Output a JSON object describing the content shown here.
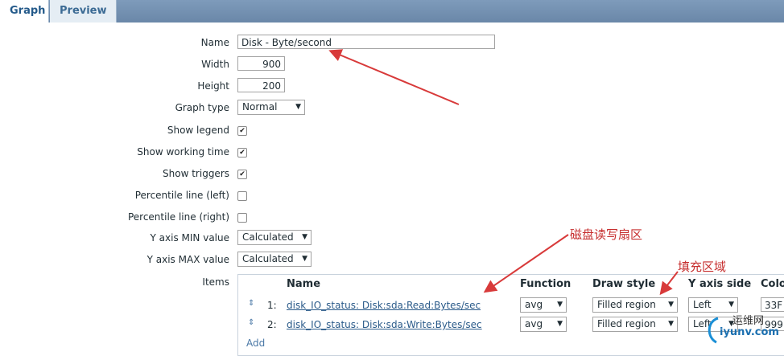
{
  "tabs": [
    {
      "label": "Graph",
      "active": true
    },
    {
      "label": "Preview",
      "active": false
    }
  ],
  "form": {
    "name": {
      "label": "Name",
      "value": "Disk - Byte/second"
    },
    "width": {
      "label": "Width",
      "value": "900"
    },
    "height": {
      "label": "Height",
      "value": "200"
    },
    "graph_type": {
      "label": "Graph type",
      "value": "Normal"
    },
    "show_legend": {
      "label": "Show legend",
      "checked": true
    },
    "show_working_time": {
      "label": "Show working time",
      "checked": true
    },
    "show_triggers": {
      "label": "Show triggers",
      "checked": true
    },
    "percentile_left": {
      "label": "Percentile line (left)",
      "checked": false
    },
    "percentile_right": {
      "label": "Percentile line (right)",
      "checked": false
    },
    "y_min": {
      "label": "Y axis MIN value",
      "value": "Calculated"
    },
    "y_max": {
      "label": "Y axis MAX value",
      "value": "Calculated"
    },
    "items_label": "Items"
  },
  "items_table": {
    "headers": [
      "Name",
      "Function",
      "Draw style",
      "Y axis side",
      "Colo"
    ],
    "rows": [
      {
        "num": "1:",
        "name": "disk_IO_status: Disk:sda:Read:Bytes/sec",
        "function": "avg",
        "draw_style": "Filled region",
        "y_side": "Left",
        "color": "33F"
      },
      {
        "num": "2:",
        "name": "disk_IO_status: Disk:sda:Write:Bytes/sec",
        "function": "avg",
        "draw_style": "Filled region",
        "y_side": "Left",
        "color": "999"
      }
    ],
    "add_label": "Add"
  },
  "annotations": {
    "disk_rw_sector": "磁盘读写扇区",
    "fill_region": "填充区域",
    "accent_color": "#d83a3a"
  },
  "watermark": {
    "line1": "运维网",
    "line2": "iyunv.com"
  }
}
